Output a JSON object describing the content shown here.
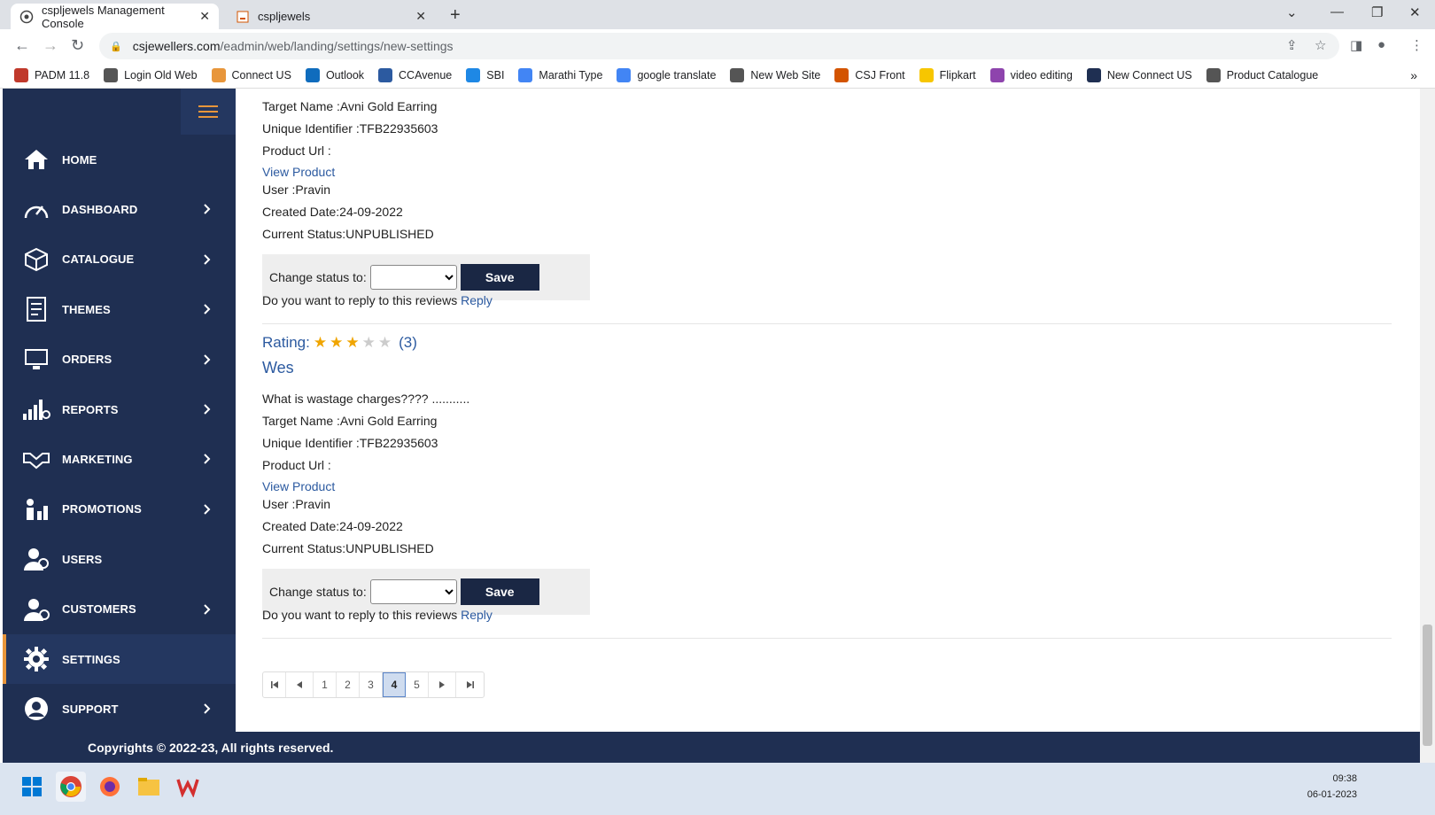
{
  "browser": {
    "tabs": [
      {
        "title": "cspljewels Management Console",
        "active": true
      },
      {
        "title": "cspljewels",
        "active": false
      }
    ],
    "url_domain": "csjewellers.com",
    "url_path": "/eadmin/web/landing/settings/new-settings",
    "bookmarks": [
      {
        "label": "PADM 11.8",
        "color": "#c0392b"
      },
      {
        "label": "Login Old Web",
        "color": "#555555"
      },
      {
        "label": "Connect US",
        "color": "#e8963b"
      },
      {
        "label": "Outlook",
        "color": "#0f6cbd"
      },
      {
        "label": "CCAvenue",
        "color": "#2c5aa0"
      },
      {
        "label": "SBI",
        "color": "#1e88e5"
      },
      {
        "label": "Marathi Type",
        "color": "#4285f4"
      },
      {
        "label": "google translate",
        "color": "#4285f4"
      },
      {
        "label": "New Web Site",
        "color": "#555555"
      },
      {
        "label": "CSJ Front",
        "color": "#d35400"
      },
      {
        "label": "Flipkart",
        "color": "#f7c600"
      },
      {
        "label": "video editing",
        "color": "#8e44ad"
      },
      {
        "label": "New Connect US",
        "color": "#1f2f52"
      },
      {
        "label": "Product Catalogue",
        "color": "#555555"
      }
    ]
  },
  "sidebar": {
    "items": [
      {
        "label": "HOME",
        "icon": "home-icon",
        "chevron": false
      },
      {
        "label": "DASHBOARD",
        "icon": "speedometer-icon",
        "chevron": true
      },
      {
        "label": "CATALOGUE",
        "icon": "cube-icon",
        "chevron": true
      },
      {
        "label": "THEMES",
        "icon": "document-icon",
        "chevron": true
      },
      {
        "label": "ORDERS",
        "icon": "monitor-icon",
        "chevron": true
      },
      {
        "label": "REPORTS",
        "icon": "bar-chart-icon",
        "chevron": true
      },
      {
        "label": "MARKETING",
        "icon": "handshake-icon",
        "chevron": true
      },
      {
        "label": "PROMOTIONS",
        "icon": "promotion-icon",
        "chevron": true
      },
      {
        "label": "USERS",
        "icon": "users-icon",
        "chevron": false
      },
      {
        "label": "CUSTOMERS",
        "icon": "customers-icon",
        "chevron": true
      },
      {
        "label": "SETTINGS",
        "icon": "gear-icon",
        "chevron": false,
        "active": true
      },
      {
        "label": "SUPPORT",
        "icon": "support-icon",
        "chevron": true
      }
    ]
  },
  "review1": {
    "target": "Target Name :Avni Gold Earring",
    "identifier": "Unique Identifier :TFB22935603",
    "product_url": "Product Url :",
    "view_product": "View Product",
    "user": "User :Pravin",
    "created": "Created Date:24-09-2022",
    "status": "Current Status:UNPUBLISHED",
    "change_label": "Change status to:",
    "save": "Save",
    "reply_prompt": "Do you want to reply to this reviews",
    "reply": "Reply"
  },
  "review2": {
    "rating_label": "Rating:",
    "rating_value": 3,
    "rating_max": 5,
    "rating_count": "(3)",
    "reviewer": "Wes",
    "comment": "What is wastage charges???? ...........",
    "target": "Target Name :Avni Gold Earring",
    "identifier": "Unique Identifier :TFB22935603",
    "product_url": "Product Url :",
    "view_product": "View Product",
    "user": "User :Pravin",
    "created": "Created Date:24-09-2022",
    "status": "Current Status:UNPUBLISHED",
    "change_label": "Change status to:",
    "save": "Save",
    "reply_prompt": "Do you want to reply to this reviews",
    "reply": "Reply"
  },
  "pagination": {
    "pages": [
      "1",
      "2",
      "3",
      "4",
      "5"
    ],
    "current": "4"
  },
  "footer": {
    "text": "Copyrights © 2022-23, All rights reserved."
  },
  "taskbar": {
    "time": "09:38",
    "date": "06-01-2023"
  }
}
